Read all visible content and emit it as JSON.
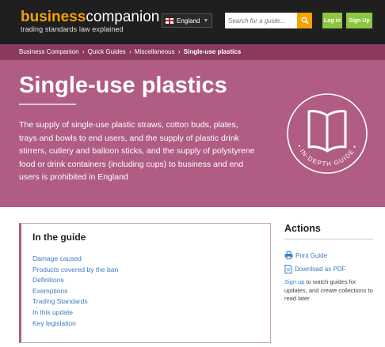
{
  "header": {
    "logo_part1": "business",
    "logo_part2": "companion",
    "tagline": "trading standards law explained",
    "region": "England",
    "search_placeholder": "Search for a guide...",
    "login_label": "Log in",
    "signup_label": "Sign Up",
    "colors": {
      "bar": "#1f1f1f",
      "accent": "#f5a200",
      "button": "#8dc63f"
    }
  },
  "breadcrumb": {
    "items": [
      "Business Companion",
      "Quick Guides",
      "Miscellaneous"
    ],
    "separator": "›",
    "current": "Single-use plastics"
  },
  "hero": {
    "title": "Single-use plastics",
    "summary": "The supply of single-use plastic straws, cotton buds, plates, trays and bowls to end users, and the supply of plastic drink stirrers, cutlery and balloon sticks, and the supply of polystyrene food or drink containers (including cups) to business and end users is prohibited in England",
    "badge_text": "IN-DEPTH GUIDE",
    "badge_icon": "open-book-icon",
    "colors": {
      "background": "#b05c84",
      "breadcrumb": "#8a3a5f"
    }
  },
  "guide": {
    "heading": "In the guide",
    "items": [
      "Damage caused",
      "Products covered by the ban",
      "Definitions",
      "Exemptions",
      "Trading Standards",
      "In this update",
      "Key legislation"
    ]
  },
  "actions": {
    "heading": "Actions",
    "print_label": "Print Guide",
    "pdf_label": "Download as PDF",
    "signup_link": "Sign up",
    "signup_text": " to watch guides for updates, and create collections to read later",
    "link_color": "#3a7cc2"
  }
}
